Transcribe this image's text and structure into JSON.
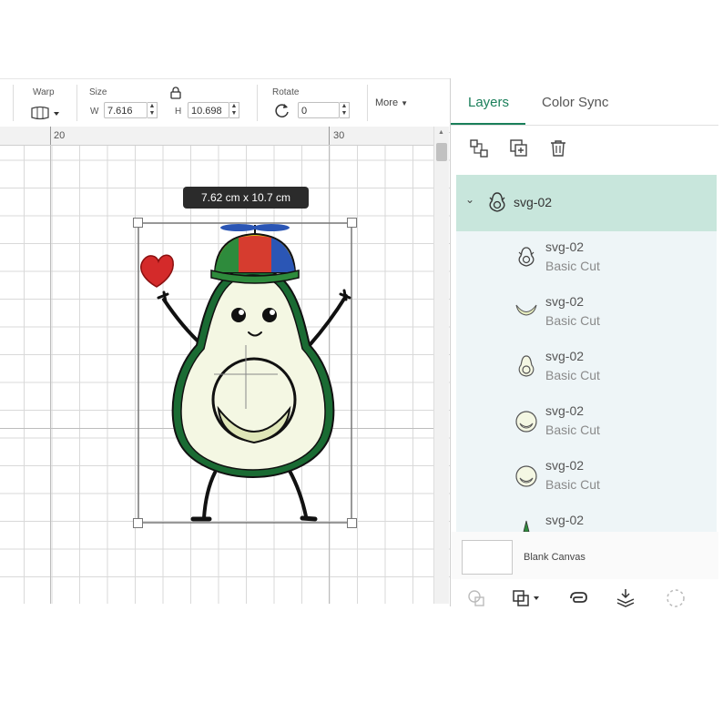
{
  "toolbar": {
    "warp_label": "Warp",
    "size_label": "Size",
    "w_label": "W",
    "w_value": "7.616",
    "h_label": "H",
    "h_value": "10.698",
    "rotate_label": "Rotate",
    "rotate_value": "0",
    "more_label": "More"
  },
  "ruler": {
    "mark_left": "20",
    "mark_right": "30"
  },
  "canvas": {
    "size_tooltip": "7.62  cm x 10.7  cm"
  },
  "panel": {
    "tabs": [
      {
        "label": "Layers"
      },
      {
        "label": "Color Sync"
      }
    ],
    "active_tab": "Layers",
    "group": {
      "name": "svg-02"
    },
    "layers": [
      {
        "name": "svg-02",
        "type": "Basic Cut",
        "icon": "avocado-outline-icon"
      },
      {
        "name": "svg-02",
        "type": "Basic Cut",
        "icon": "crescent-icon"
      },
      {
        "name": "svg-02",
        "type": "Basic Cut",
        "icon": "avocado-body-icon"
      },
      {
        "name": "svg-02",
        "type": "Basic Cut",
        "icon": "pit-icon"
      },
      {
        "name": "svg-02",
        "type": "Basic Cut",
        "icon": "pit-icon"
      },
      {
        "name": "svg-02",
        "type": "",
        "icon": "small-leaf-icon"
      }
    ],
    "blank_canvas_label": "Blank Canvas"
  },
  "colors": {
    "accent": "#1a7f5a",
    "group_row_bg": "#c8e6dc",
    "layer_bg": "#eef5f7"
  }
}
